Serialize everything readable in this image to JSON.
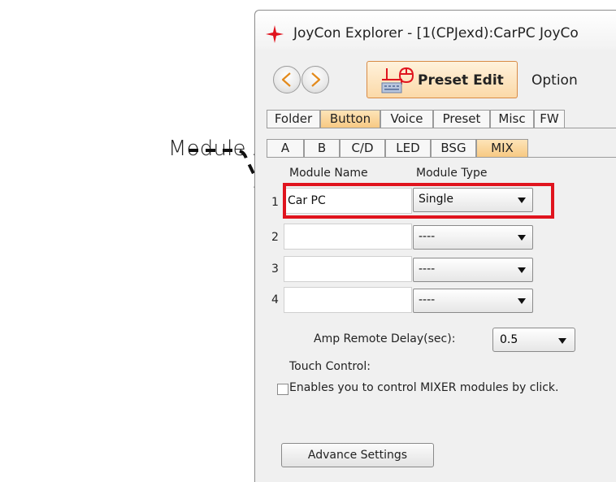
{
  "annotation": {
    "label": "Module Address"
  },
  "window": {
    "title": "JoyCon Explorer - [1(CPJexd):CarPC JoyCo"
  },
  "toolbar": {
    "back_icon": "chevron-left-icon",
    "forward_icon": "chevron-right-icon",
    "preset_edit_label": "Preset Edit",
    "option_label": "Option",
    "accent": "#f7c983",
    "border_accent": "#d88b46"
  },
  "main_tabs": [
    {
      "label": "Folder"
    },
    {
      "label": "Button"
    },
    {
      "label": "Voice"
    },
    {
      "label": "Preset"
    },
    {
      "label": "Misc"
    },
    {
      "label": "FW"
    }
  ],
  "sub_tabs": [
    {
      "label": "A"
    },
    {
      "label": "B"
    },
    {
      "label": "C/D"
    },
    {
      "label": "LED"
    },
    {
      "label": "BSG"
    },
    {
      "label": "MIX"
    }
  ],
  "columns": {
    "name": "Module Name",
    "type": "Module Type"
  },
  "modules": [
    {
      "num": "1",
      "name": "Car PC",
      "type": "Single"
    },
    {
      "num": "2",
      "name": "",
      "type": "----"
    },
    {
      "num": "3",
      "name": "",
      "type": "----"
    },
    {
      "num": "4",
      "name": "",
      "type": "----"
    }
  ],
  "amp": {
    "label": "Amp Remote Delay(sec):",
    "value": "0.5"
  },
  "touch": {
    "title": "Touch Control:",
    "description": "Enables you to control MIXER modules by click.",
    "checked": false
  },
  "advance_button": "Advance Settings",
  "highlight_color": "#e0141e"
}
